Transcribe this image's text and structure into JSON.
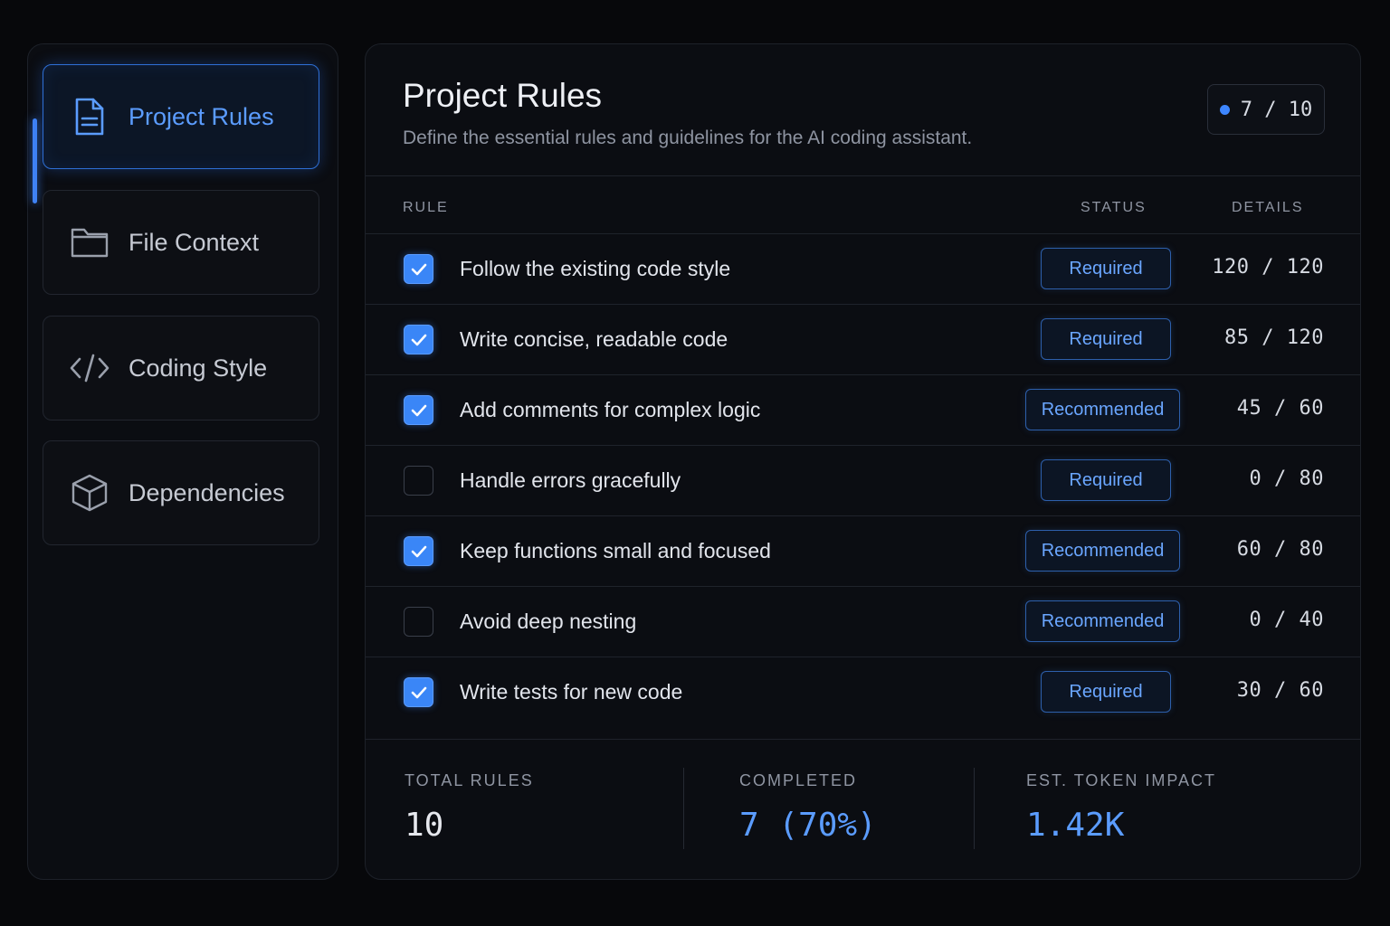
{
  "sidebar": {
    "items": [
      {
        "label": "Project Rules",
        "icon": "document-icon",
        "active": true
      },
      {
        "label": "File Context",
        "icon": "folder-icon",
        "active": false
      },
      {
        "label": "Coding Style",
        "icon": "code-icon",
        "active": false
      },
      {
        "label": "Dependencies",
        "icon": "cube-icon",
        "active": false
      }
    ]
  },
  "header": {
    "title": "Project Rules",
    "subtitle": "Define the essential rules and guidelines for the AI coding assistant.",
    "progress": "7 / 10"
  },
  "table": {
    "columns": {
      "rule": "RULE",
      "status": "STATUS",
      "details": "DETAILS"
    },
    "rows": [
      {
        "checked": true,
        "rule": "Follow the existing code style",
        "status": "Required",
        "details": "120 / 120"
      },
      {
        "checked": true,
        "rule": "Write concise, readable code",
        "status": "Required",
        "details": "85 / 120"
      },
      {
        "checked": true,
        "rule": "Add comments for complex logic",
        "status": "Recommended",
        "details": "45 / 60"
      },
      {
        "checked": false,
        "rule": "Handle errors gracefully",
        "status": "Required",
        "details": "0 / 80"
      },
      {
        "checked": true,
        "rule": "Keep functions small and focused",
        "status": "Recommended",
        "details": "60 / 80"
      },
      {
        "checked": false,
        "rule": "Avoid deep nesting",
        "status": "Recommended",
        "details": "0 / 40"
      },
      {
        "checked": true,
        "rule": "Write tests for new code",
        "status": "Required",
        "details": "30 / 60"
      }
    ]
  },
  "stats": {
    "total_label": "TOTAL RULES",
    "total_value": "10",
    "completed_label": "COMPLETED",
    "completed_value": "7 (70%)",
    "token_label": "EST. TOKEN IMPACT",
    "token_value": "1.42K"
  },
  "colors": {
    "accent": "#3d86ff",
    "background": "#07080b",
    "panel": "#0b0d12"
  }
}
